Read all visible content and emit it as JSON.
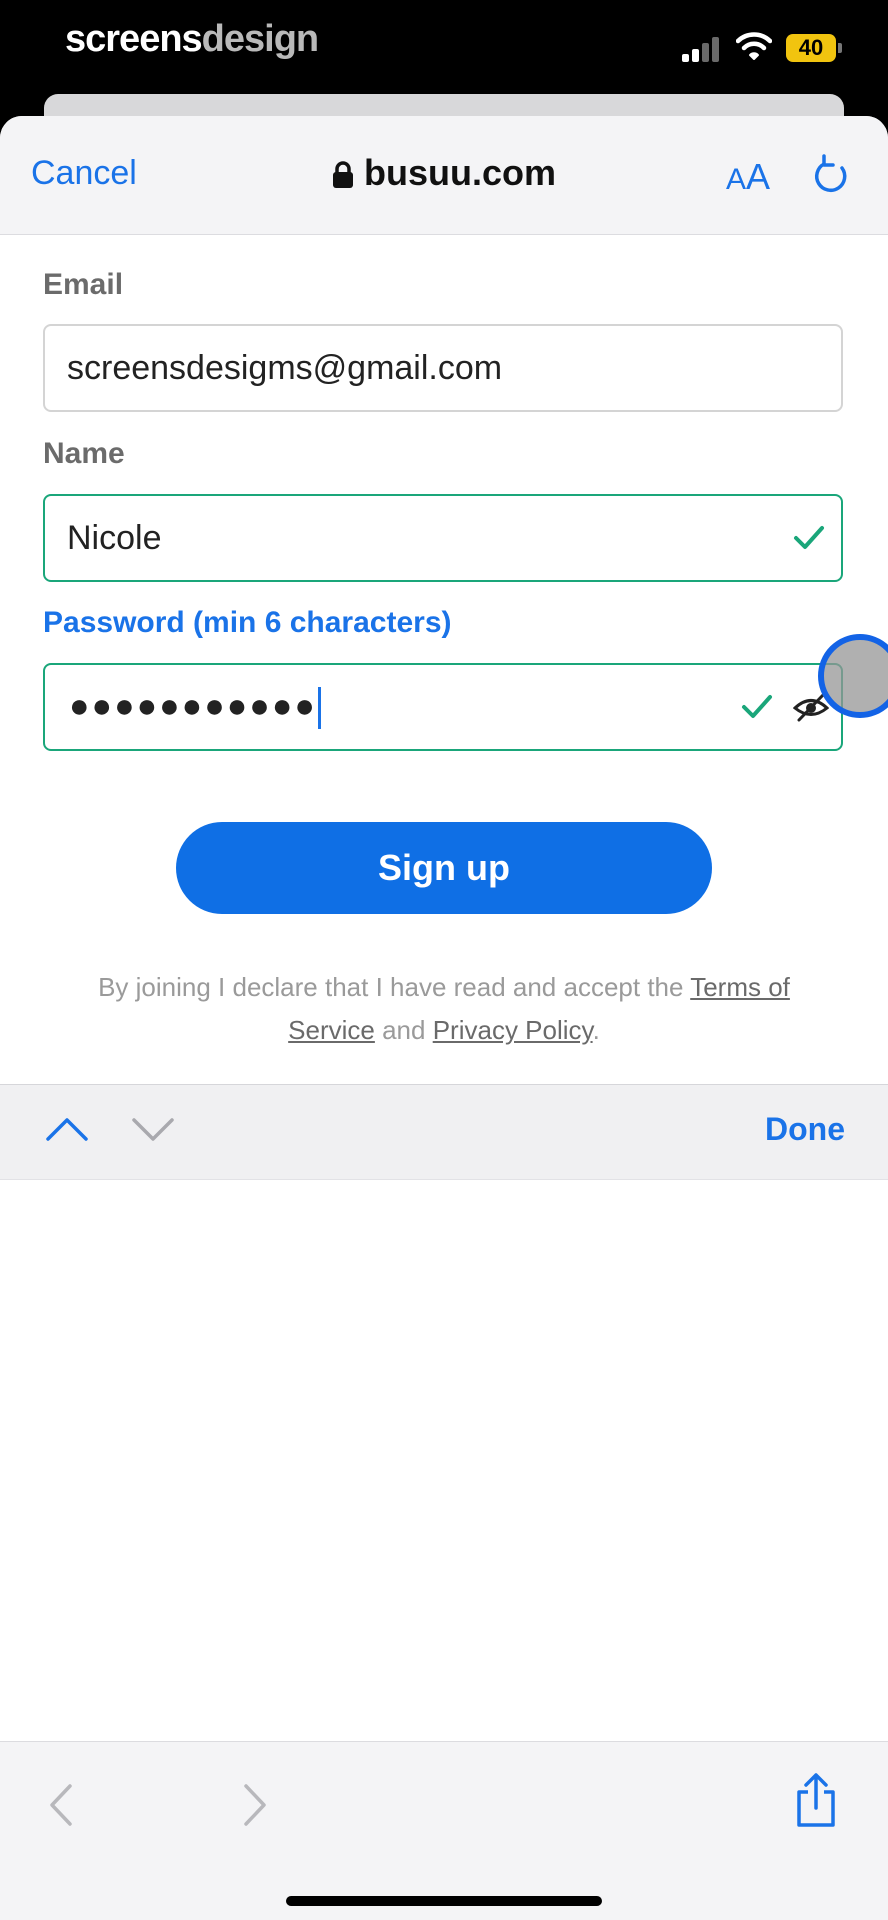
{
  "status_bar": {
    "brand_part1": "screens",
    "brand_part2": "design",
    "battery": "40"
  },
  "browser": {
    "cancel_label": "Cancel",
    "url": "busuu.com",
    "text_size_small": "A",
    "text_size_large": "A"
  },
  "form": {
    "email_label": "Email",
    "email_value": "screensdesigms@gmail.com",
    "name_label": "Name",
    "name_value": "Nicole",
    "password_label": "Password (min 6 characters)",
    "password_masked": "●●●●●●●●●●●",
    "signup_label": "Sign up",
    "terms_prefix": "By joining I declare that I have read and accept the ",
    "terms_link": "Terms of Service",
    "terms_and": " and ",
    "privacy_link": "Privacy Policy",
    "terms_suffix": "."
  },
  "accessory": {
    "done_label": "Done"
  },
  "colors": {
    "accent": "#1a73e8",
    "valid": "#1aa67a",
    "button": "#0f6fe5"
  }
}
